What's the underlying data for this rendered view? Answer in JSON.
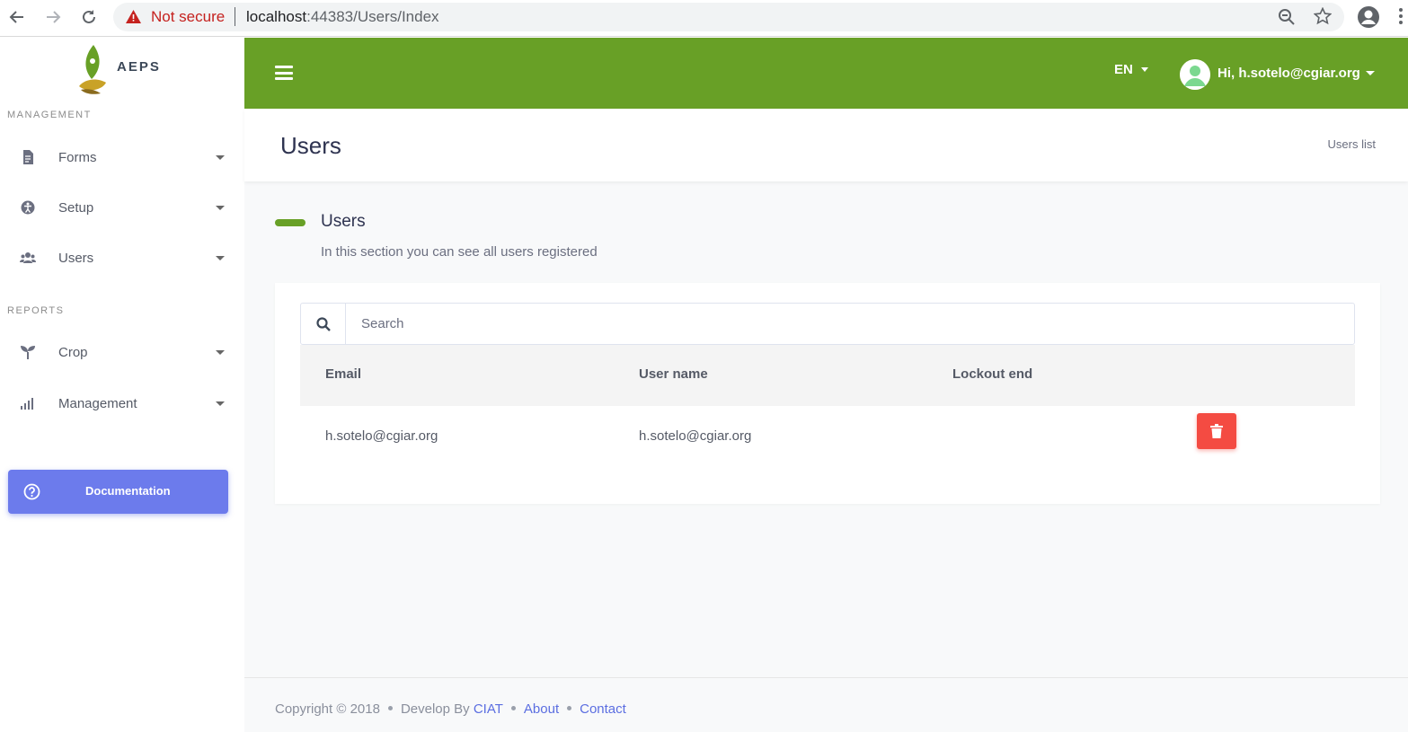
{
  "browser": {
    "security_label": "Not secure",
    "url_host": "localhost",
    "url_path": ":44383/Users/Index"
  },
  "sidebar": {
    "brand": "AEPS",
    "management_label": "MANAGEMENT",
    "reports_label": "REPORTS",
    "items": [
      {
        "label": "Forms",
        "icon": "document-icon"
      },
      {
        "label": "Setup",
        "icon": "setup-icon"
      },
      {
        "label": "Users",
        "icon": "users-icon"
      },
      {
        "label": "Crop",
        "icon": "sprout-icon"
      },
      {
        "label": "Management",
        "icon": "bar-chart-icon"
      }
    ],
    "documentation_label": "Documentation"
  },
  "topbar": {
    "language": "EN",
    "greeting": "Hi, h.sotelo@cgiar.org"
  },
  "header": {
    "title": "Users",
    "breadcrumb": "Users list"
  },
  "section": {
    "title": "Users",
    "description": "In this section you can see all users registered"
  },
  "search": {
    "placeholder": "Search"
  },
  "table": {
    "columns": [
      "Email",
      "User name",
      "Lockout end"
    ],
    "rows": [
      {
        "email": "h.sotelo@cgiar.org",
        "username": "h.sotelo@cgiar.org",
        "lockout_end": ""
      }
    ]
  },
  "footer": {
    "copyright": "Copyright © 2018",
    "develop_by": "Develop By",
    "ciat": "CIAT",
    "about": "About",
    "contact": "Contact"
  },
  "colors": {
    "accent_green": "#68a026",
    "doc_button": "#6c7bec",
    "delete_button": "#f44b42",
    "link": "#5b6ee1"
  }
}
